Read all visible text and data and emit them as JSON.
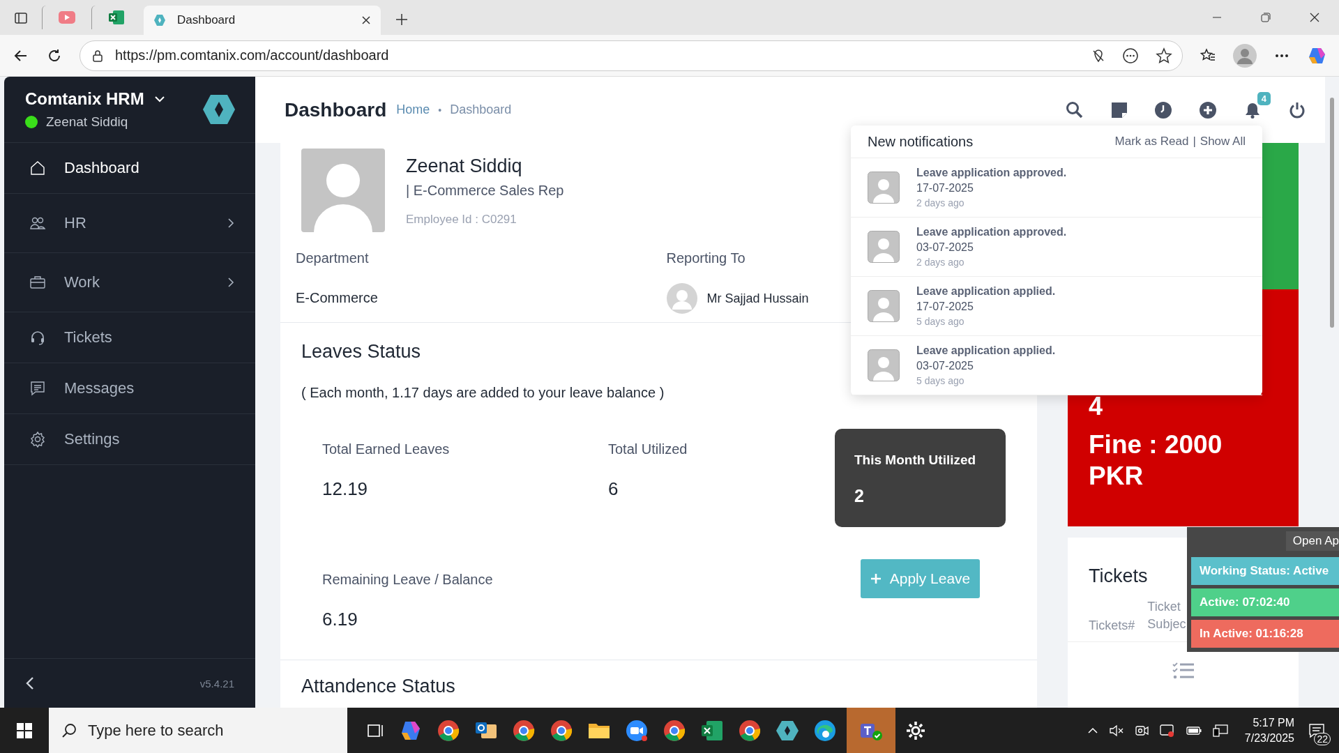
{
  "browser": {
    "tabs": [
      {
        "kind": "pinned-video",
        "selected": false
      },
      {
        "kind": "pinned-sheet",
        "selected": false
      },
      {
        "kind": "page",
        "title": "Dashboard",
        "selected": true
      }
    ],
    "address": "https://pm.comtanix.com/account/dashboard"
  },
  "sidebar": {
    "brand": "Comtanix HRM",
    "user": "Zeenat Siddiq",
    "online": true,
    "items": [
      {
        "label": "Dashboard",
        "selected": true,
        "expandable": false
      },
      {
        "label": "HR",
        "selected": false,
        "expandable": true
      },
      {
        "label": "Work",
        "selected": false,
        "expandable": true
      },
      {
        "label": "Tickets",
        "selected": false,
        "expandable": false
      },
      {
        "label": "Messages",
        "selected": false,
        "expandable": false
      },
      {
        "label": "Settings",
        "selected": false,
        "expandable": false
      }
    ],
    "version": "v5.4.21"
  },
  "header": {
    "title": "Dashboard",
    "breadcrumb": [
      "Home",
      "Dashboard"
    ],
    "breadcrumb_separator": "•",
    "notification_count": "4"
  },
  "notifications": {
    "title": "New notifications",
    "actions": [
      "Mark as Read",
      "Show All"
    ],
    "action_separator": "|",
    "items": [
      {
        "title": "Leave application approved.",
        "date": "17-07-2025",
        "age": "2 days ago"
      },
      {
        "title": "Leave application approved.",
        "date": "03-07-2025",
        "age": "2 days ago"
      },
      {
        "title": "Leave application applied.",
        "date": "17-07-2025",
        "age": "5 days ago"
      },
      {
        "title": "Leave application applied.",
        "date": "03-07-2025",
        "age": "5 days ago"
      }
    ]
  },
  "profile": {
    "name": "Zeenat Siddiq",
    "role": "| E-Commerce Sales Rep",
    "employee_id": "Employee Id : C0291",
    "department_label": "Department",
    "department": "E-Commerce",
    "reporting_label": "Reporting To",
    "reporting_to": "Mr Sajjad Hussain"
  },
  "leaves": {
    "title": "Leaves Status",
    "note": "( Each month, 1.17 days are added to your leave balance )",
    "stats": [
      {
        "kind": "plain",
        "label": "Total Earned Leaves",
        "value": "12.19"
      },
      {
        "kind": "plain",
        "label": "Total Utilized",
        "value": "6"
      },
      {
        "kind": "dark",
        "label": "This Month Utilized",
        "value": "2"
      },
      {
        "kind": "plain",
        "label": "Remaining Leave / Balance",
        "value": "6.19"
      }
    ],
    "apply_button": "Apply Leave"
  },
  "attendance": {
    "title": "Attandence Status"
  },
  "fine_panel": {
    "value": "4",
    "fine": "Fine : 2000 PKR"
  },
  "tickets": {
    "title": "Tickets",
    "columns": [
      "Tickets#",
      "Ticket Subjec"
    ]
  },
  "tracker": {
    "open_app": "Open Ap",
    "statuses": [
      {
        "text": "Working Status: Active",
        "color": "#5bc0cb"
      },
      {
        "text": "Active: 07:02:40",
        "color": "#4fd08a"
      },
      {
        "text": "In Active: 01:16:28",
        "color": "#ee6b5e"
      }
    ]
  },
  "taskbar": {
    "search_placeholder": "Type here to search",
    "time": "5:17 PM",
    "date": "7/23/2025",
    "notification_count": "22"
  }
}
